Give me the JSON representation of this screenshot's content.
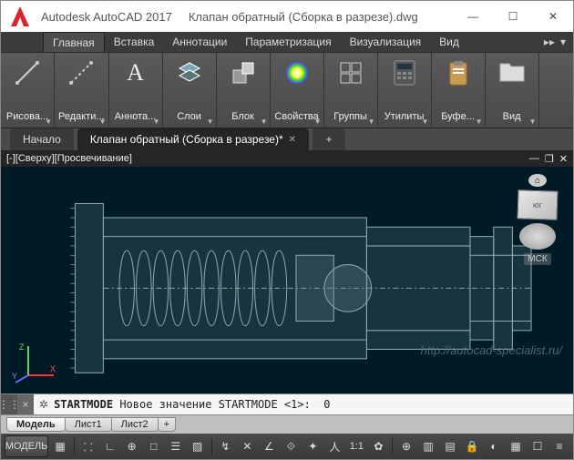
{
  "title_app": "Autodesk AutoCAD 2017",
  "title_file": "Клапан обратный (Сборка в разрезе).dwg",
  "menu_tabs": [
    "Главная",
    "Вставка",
    "Аннотации",
    "Параметризация",
    "Визуализация",
    "Вид"
  ],
  "menu_active": 0,
  "ribbon": [
    {
      "label": "Рисова...",
      "icon": "line-icon"
    },
    {
      "label": "Редакти...",
      "icon": "edit-icon"
    },
    {
      "label": "Аннота...",
      "icon": "text-icon",
      "glyph": "A"
    },
    {
      "label": "Слои",
      "icon": "layers-icon"
    },
    {
      "label": "Блок",
      "icon": "block-icon"
    },
    {
      "label": "Свойства",
      "icon": "properties-icon"
    },
    {
      "label": "Группы",
      "icon": "groups-icon"
    },
    {
      "label": "Утилиты",
      "icon": "calc-icon"
    },
    {
      "label": "Буфе...",
      "icon": "clipboard-icon"
    },
    {
      "label": "Вид",
      "icon": "folder-icon"
    }
  ],
  "doc_tabs": [
    {
      "label": "Начало",
      "active": false,
      "closable": false
    },
    {
      "label": "Клапан обратный (Сборка в разрезе)*",
      "active": true,
      "closable": true
    }
  ],
  "viewport_label": "[-][Сверху][Просвечивание]",
  "viewcube_face": "юг",
  "ucs_label": "МСК",
  "watermark": "http://autocad-specialist.ru/",
  "command_text": "STARTMODE Новое значение STARTMODE <1>:  0",
  "layout_tabs": [
    "Модель",
    "Лист1",
    "Лист2"
  ],
  "layout_active": 0,
  "status_model": "МОДЕЛЬ",
  "status_scale": "1:1"
}
